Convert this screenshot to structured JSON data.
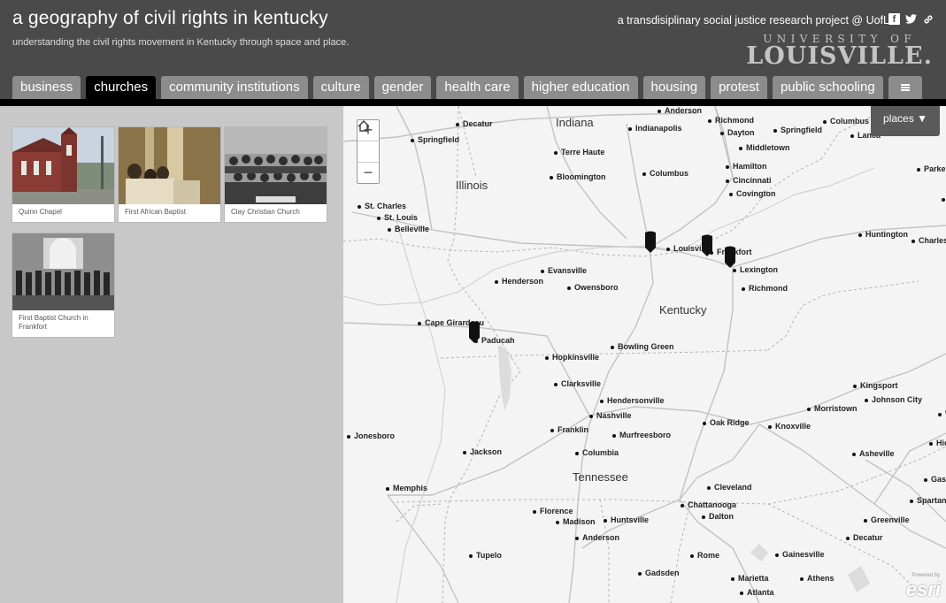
{
  "header": {
    "title": "a geography of civil rights in kentucky",
    "subtitle": "understanding the civil rights movement in Kentucky through space and place.",
    "tagline": "a transdisiplinary social justice research project @ UofL",
    "logo_top": "UNIVERSITY OF",
    "logo_bottom": "LOUISVILLE.",
    "social": [
      "facebook-icon",
      "twitter-icon",
      "link-icon"
    ]
  },
  "tabs": [
    {
      "label": "business",
      "active": false
    },
    {
      "label": "churches",
      "active": true
    },
    {
      "label": "community institutions",
      "active": false
    },
    {
      "label": "culture",
      "active": false
    },
    {
      "label": "gender",
      "active": false
    },
    {
      "label": "health care",
      "active": false
    },
    {
      "label": "higher education",
      "active": false
    },
    {
      "label": "housing",
      "active": false
    },
    {
      "label": "protest",
      "active": false
    },
    {
      "label": "public schooling",
      "active": false
    }
  ],
  "cards": [
    {
      "label": "Quinn Chapel"
    },
    {
      "label": "First African Baptist"
    },
    {
      "label": "Clay Christian Church"
    },
    {
      "label": "First Baptist Church in Frankfort"
    }
  ],
  "map": {
    "places_button": "places ▼",
    "zoom_in": "+",
    "zoom_out": "−",
    "logo": "esri",
    "attribution": "Powered by",
    "states": [
      "Indiana",
      "Illinois",
      "Kentucky",
      "Tennessee"
    ],
    "cities": [
      "Decatur",
      "Springfield",
      "Anderson",
      "Richmond",
      "Columbus",
      "Lanca",
      "Indianapolis",
      "Dayton",
      "Springfield",
      "Middletown",
      "Parkersb",
      "Terre Haute",
      "Hamilton",
      "Cincinnati",
      "Bloomington",
      "Columbus",
      "Covington",
      "St. Charles",
      "St. Louis",
      "Belleville",
      "Louisville",
      "Frankfort",
      "Huntington",
      "Charleston",
      "Lexington",
      "Evansville",
      "Henderson",
      "Owensboro",
      "Richmond",
      "Cape Girardeau",
      "Paducah",
      "Bowling Green",
      "Hopkinsville",
      "Clarksville",
      "Hendersonville",
      "Nashville",
      "Kingsport",
      "Johnson City",
      "Morristown",
      "Franklin",
      "Murfreesboro",
      "Oak Ridge",
      "Knoxville",
      "Jonesboro",
      "Columbia",
      "Jackson",
      "Asheville",
      "Hick",
      "Memphis",
      "Cleveland",
      "Gastonia",
      "Chattanooga",
      "Spartanburg",
      "Dalton",
      "Greenville",
      "Florence",
      "Madison",
      "Huntsville",
      "Anderson",
      "Decatur",
      "Gainesville",
      "Tupelo",
      "Rome",
      "Gadsden",
      "Marietta",
      "Athens",
      "Atlanta",
      "Win",
      "W"
    ]
  }
}
